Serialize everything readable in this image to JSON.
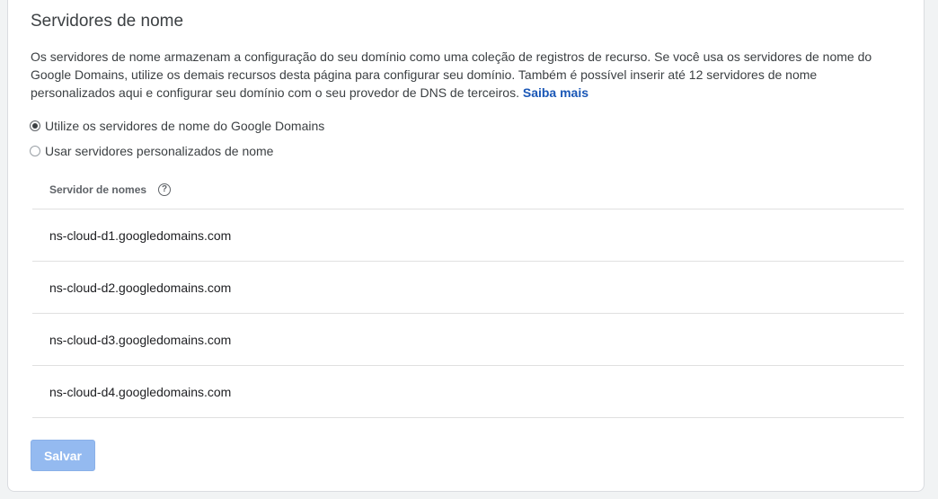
{
  "section": {
    "title": "Servidores de nome",
    "description": "Os servidores de nome armazenam a configuração do seu domínio como uma coleção de registros de recurso. Se você usa os servidores de nome do Google Domains, utilize os demais recursos desta página para configurar seu domínio. Também é possível inserir até 12 servidores de nome personalizados aqui e configurar seu domínio com o seu provedor de DNS de terceiros.",
    "learn_more": "Saiba mais"
  },
  "options": [
    {
      "label": "Utilize os servidores de nome do Google Domains",
      "checked": true
    },
    {
      "label": "Usar servidores personalizados de nome",
      "checked": false
    }
  ],
  "table": {
    "header": "Servidor de nomes",
    "help_icon": "help-circle-icon",
    "rows": [
      "ns-cloud-d1.googledomains.com",
      "ns-cloud-d2.googledomains.com",
      "ns-cloud-d3.googledomains.com",
      "ns-cloud-d4.googledomains.com"
    ]
  },
  "actions": {
    "save_label": "Salvar",
    "save_enabled": false
  },
  "colors": {
    "link": "#1a57b6",
    "save_button_disabled": "#94baf0"
  }
}
